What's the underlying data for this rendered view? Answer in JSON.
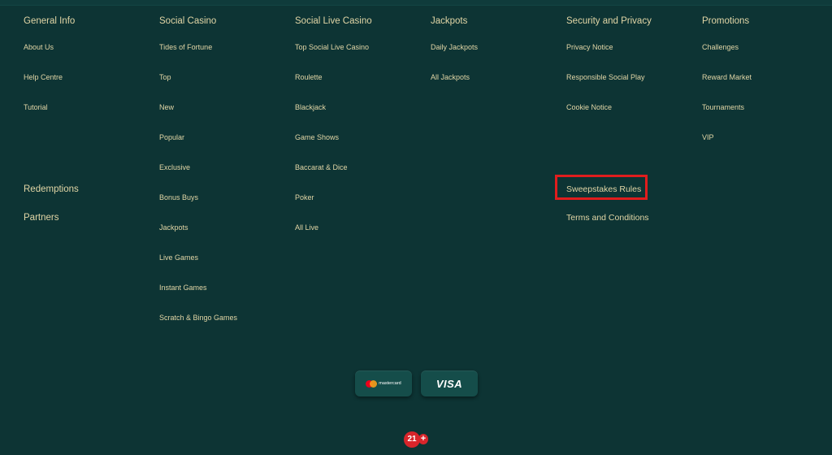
{
  "columns": [
    {
      "heading": "General Info",
      "links": [
        "About Us",
        "Help Centre",
        "Tutorial"
      ],
      "extra_headings": [
        "Redemptions",
        "Partners"
      ]
    },
    {
      "heading": "Social Casino",
      "links": [
        "Tides of Fortune",
        "Top",
        "New",
        "Popular",
        "Exclusive",
        "Bonus Buys",
        "Jackpots",
        "Live Games",
        "Instant Games",
        "Scratch & Bingo Games"
      ]
    },
    {
      "heading": "Social Live Casino",
      "links": [
        "Top Social Live Casino",
        "Roulette",
        "Blackjack",
        "Game Shows",
        "Baccarat & Dice",
        "Poker",
        "All Live"
      ]
    },
    {
      "heading": "Jackpots",
      "links": [
        "Daily Jackpots",
        "All Jackpots"
      ]
    },
    {
      "heading": "Security and Privacy",
      "links": [
        "Privacy Notice",
        "Responsible Social Play",
        "Cookie Notice"
      ],
      "extra_headings": [
        "Sweepstakes Rules",
        "Terms and Conditions"
      ]
    },
    {
      "heading": "Promotions",
      "links": [
        "Challenges",
        "Reward Market",
        "Tournaments",
        "VIP"
      ]
    }
  ],
  "payments": {
    "mastercard": "mastercard",
    "visa": "VISA"
  },
  "age_badge": {
    "number": "21",
    "plus": "+"
  },
  "colors": {
    "background": "#0d3434",
    "text": "#e2d6a6",
    "highlight": "#e01d1d",
    "badge": "#d8252b"
  }
}
